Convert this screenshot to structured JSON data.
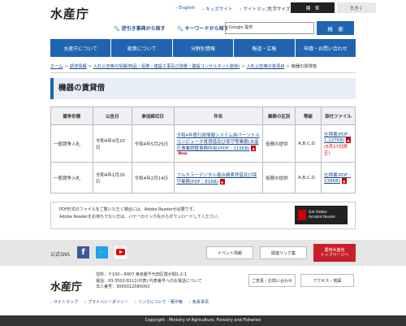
{
  "header": {
    "logo": "水産庁",
    "top_links": [
      "English",
      "キッズサイト",
      "サイトマップ"
    ],
    "font_size_label": "文字サイズ",
    "font_size_standard": "標　準",
    "font_size_large": "大きく",
    "search_kana_label": "逆引き事典から探す",
    "search_keyword_label": "キーワードから探す",
    "search_placeholder": "Google 提供",
    "search_button": "検　索"
  },
  "nav": [
    "水産庁について",
    "政策について",
    "分野別情報",
    "報道・広報",
    "申請・お問い合わせ"
  ],
  "breadcrumb": [
    "ホーム",
    "調達情報",
    "入札公告等の情報(物品・役務・建設工事及び測量・建設コンサルタント関係)",
    "入札公告等の各項目",
    "機器の賃貸借"
  ],
  "page_title": "機器の賃貸借",
  "table": {
    "headers": [
      "競争形態",
      "公告日",
      "参加締切日",
      "件名",
      "業務の区別",
      "等級",
      "添付ファイル"
    ],
    "rows": [
      {
        "type": "一般競争入札",
        "notice_date": "令和4年4月20日",
        "deadline": "令和4年5月25日",
        "subject": "令和4年度行政情報システム用パーソナルコンピュータ賃貸借及び保守等業務(水産庁漁業調整事務所用)",
        "subject_pdf": "(PDF : 115KB)",
        "new_label": "New",
        "category": "役務の提供",
        "grade": "A,B,C,D",
        "file_link": "仕様書(PDF : 1,127KB)",
        "file_note": "(5月17日修正)"
      },
      {
        "type": "一般競争入札",
        "notice_date": "令和4年1月26日",
        "deadline": "令和4年2月14日",
        "subject": "フルカラーデジタル複合機賃貸借及び保守業務",
        "subject_pdf": "(PDF : 81KB)",
        "new_label": "",
        "category": "役務の提供",
        "grade": "A,B,C,D",
        "file_link": "仕様書(PDF : 239KB)",
        "file_note": ""
      }
    ]
  },
  "pdf_notice": {
    "line1": "PDF形式のファイルをご覧いただく場合には、Adobe Readerが必要です。",
    "line2": "Adobe Readerをお持ちでない方は、バナーのリンク先からダウンロードしてください。",
    "banner_line1": "Get Adobe",
    "banner_line2": "Acrobat Reader"
  },
  "footer": {
    "sns_label": "公式SNS",
    "event_button": "イベント情報",
    "links_button": "関連リンク集",
    "red_button_line1": "農林水産省",
    "red_button_line2": "トップページへ",
    "logo": "水産庁",
    "address_line1": "住所：〒100－8907 東京都千代田区霞が関1-2-1",
    "address_line2": "電話：03-3502-8111(代表) 代表番号へのお電話について",
    "address_line3": "法人番号：3000012080003",
    "contact_button": "ご意見・お問い合わせ",
    "access_button": "アクセス・地図",
    "bottom_links": [
      "サイトマップ",
      "プライバシーポリシー",
      "リンクについて・著作権",
      "免責事項"
    ],
    "copyright": "Copyright : Ministry of Agriculture, Forestry and Fisheries"
  }
}
